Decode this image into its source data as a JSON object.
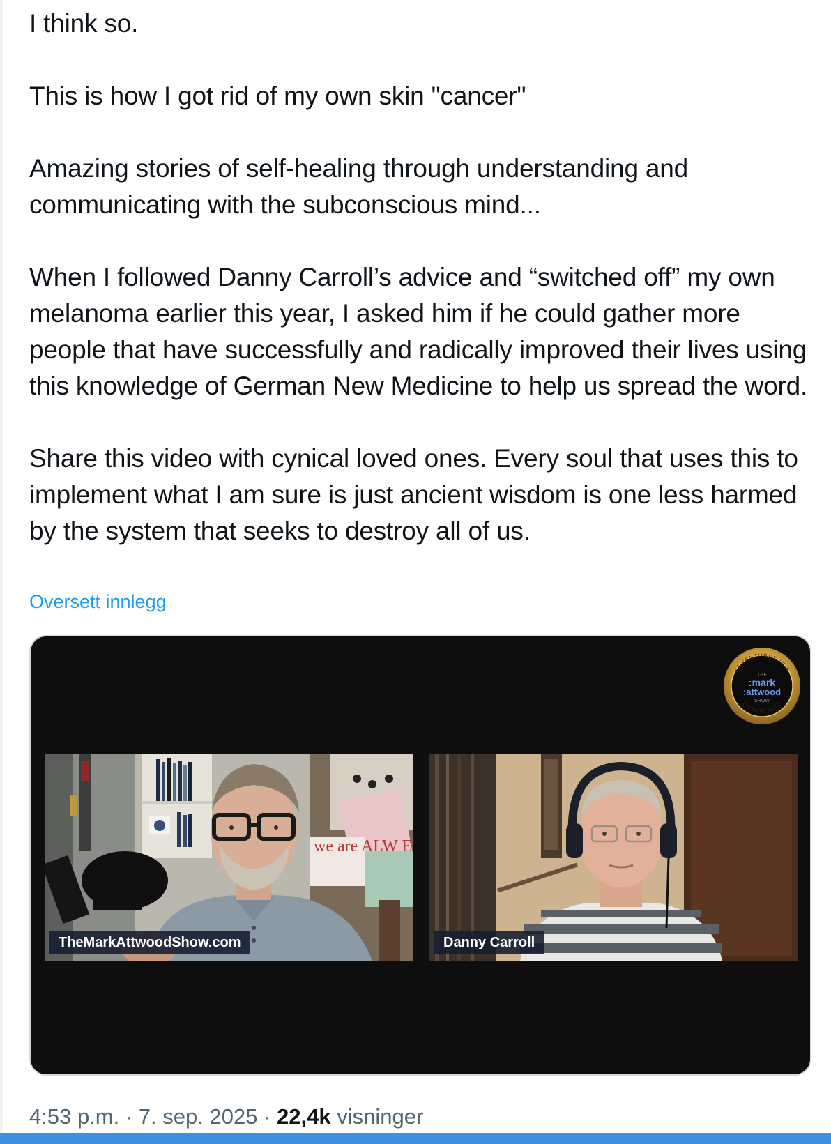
{
  "post": {
    "paragraphs": [
      "I think so.",
      "This is how I got rid of my own skin \"cancer\"",
      "Amazing stories of self-healing through understanding and communicating with the subconscious mind...",
      "When I followed Danny Carroll’s advice and “switched off” my own melanoma earlier this year, I asked him if he could gather more people that have successfully and radically improved their lives using this knowledge of German New Medicine to help us spread the word.",
      "Share this video with cynical loved ones. Every soul that uses this to implement what I am sure is just ancient wisdom is one less harmed by the system that seeks to destroy all of us."
    ],
    "translate_label": "Oversett innlegg"
  },
  "video": {
    "logo": {
      "arc_top": "ADVENTURES IN A",
      "the": "THE",
      "line1": ":mark",
      "line2": ":attwood",
      "show": "SHOW",
      "arc_bottom": "COSMIC SUIT"
    },
    "participants": [
      {
        "name": "TheMarkAttwoodShow.com"
      },
      {
        "name": "Danny Carroll"
      }
    ],
    "background_sign": "we are ALW ER"
  },
  "meta": {
    "time": "4:53 p.m.",
    "separator": " · ",
    "date": "7. sep. 2025",
    "views_count": "22,4k",
    "views_label": "visninger"
  },
  "colors": {
    "link": "#1d9bf0",
    "video_bg": "#0e0e0e",
    "bottom_bar": "#3d8fe0",
    "muted_text": "#536471"
  }
}
